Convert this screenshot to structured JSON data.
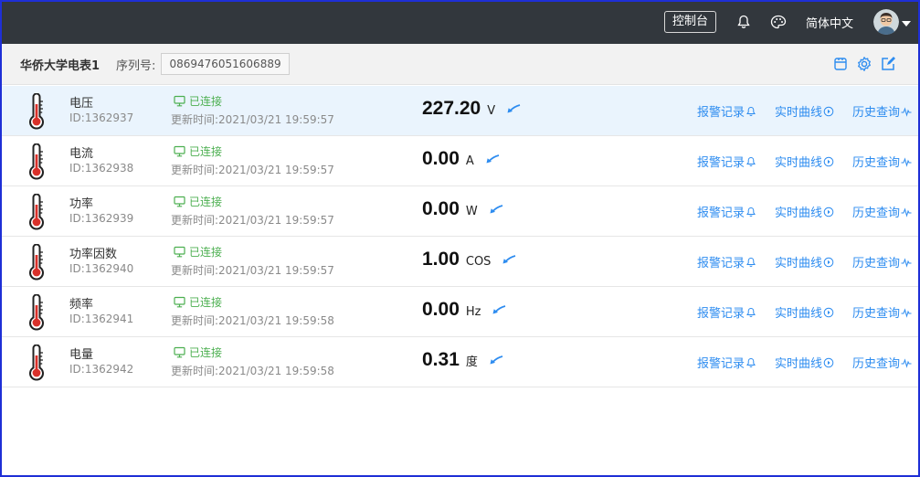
{
  "topbar": {
    "console_label": "控制台",
    "language_label": "简体中文",
    "bell_icon": "bell-icon",
    "palette_icon": "palette-icon"
  },
  "device": {
    "name": "华侨大学电表1",
    "serial_label": "序列号:",
    "serial_value": "0869476051606889"
  },
  "colors": {
    "topbar_bg": "#32373d",
    "link": "#2d8cf0",
    "connected": "#4caf50",
    "active_row_bg": "#eaf4fd",
    "thermometer_bulb": "#d9312b"
  },
  "row_labels": {
    "alarm": "报警记录",
    "realtime": "实时曲线",
    "history": "历史查询"
  },
  "rows": [
    {
      "name": "电压",
      "id": "ID:1362937",
      "status": "已连接",
      "time": "更新时间:2021/03/21 19:59:57",
      "value": "227.20",
      "unit": "V"
    },
    {
      "name": "电流",
      "id": "ID:1362938",
      "status": "已连接",
      "time": "更新时间:2021/03/21 19:59:57",
      "value": "0.00",
      "unit": "A"
    },
    {
      "name": "功率",
      "id": "ID:1362939",
      "status": "已连接",
      "time": "更新时间:2021/03/21 19:59:57",
      "value": "0.00",
      "unit": "W"
    },
    {
      "name": "功率因数",
      "id": "ID:1362940",
      "status": "已连接",
      "time": "更新时间:2021/03/21 19:59:57",
      "value": "1.00",
      "unit": "COS"
    },
    {
      "name": "频率",
      "id": "ID:1362941",
      "status": "已连接",
      "time": "更新时间:2021/03/21 19:59:58",
      "value": "0.00",
      "unit": "Hz"
    },
    {
      "name": "电量",
      "id": "ID:1362942",
      "status": "已连接",
      "time": "更新时间:2021/03/21 19:59:58",
      "value": "0.31",
      "unit": "度"
    }
  ]
}
